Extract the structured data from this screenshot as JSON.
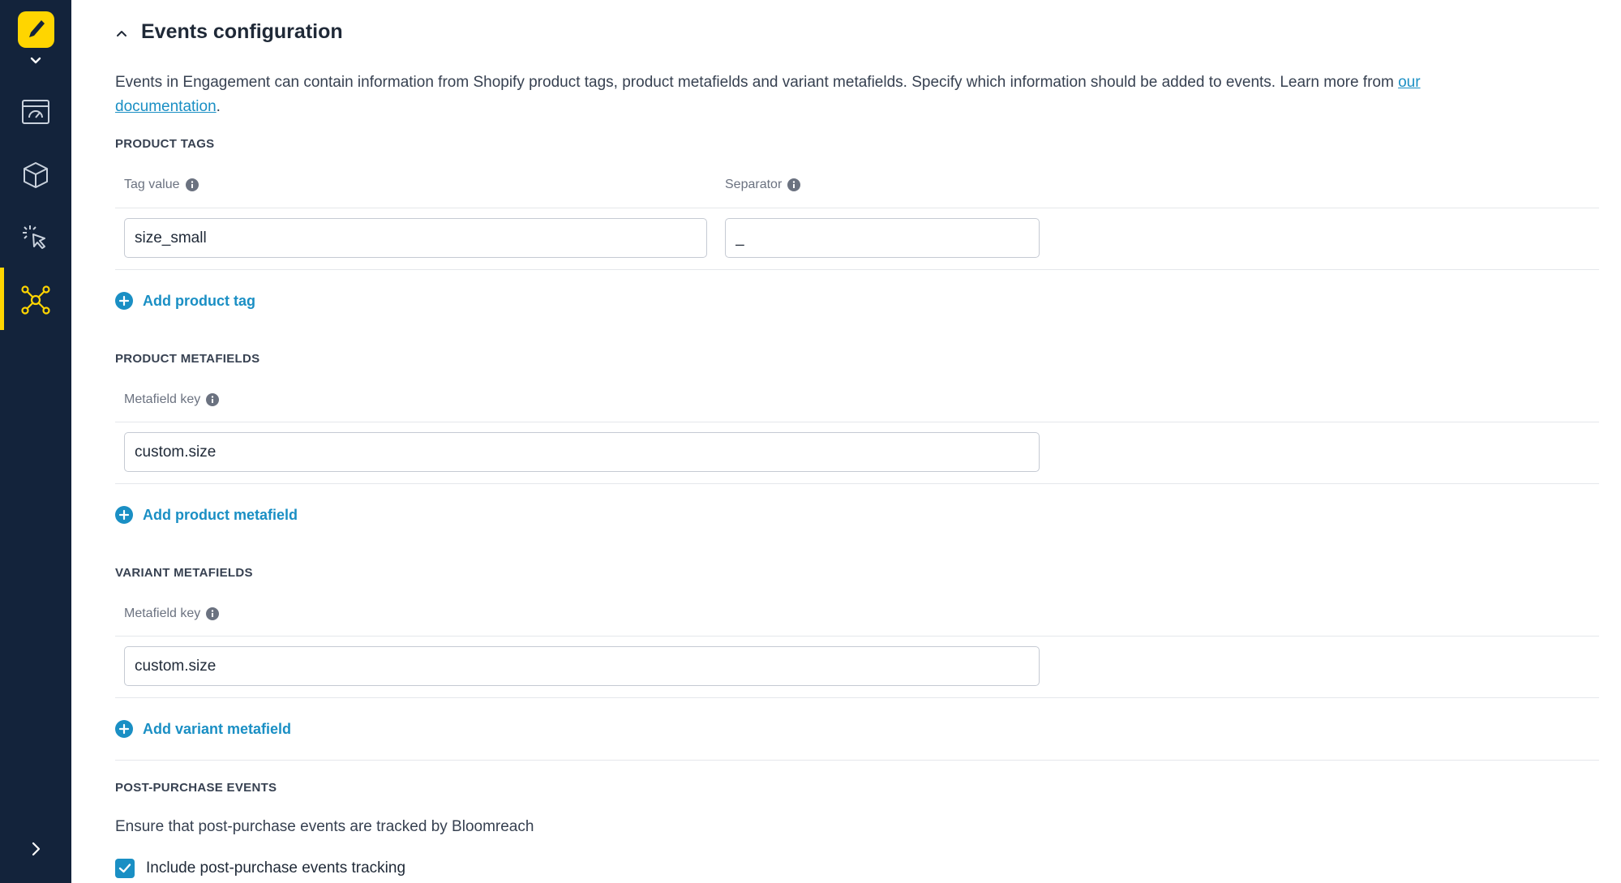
{
  "sidebar": {
    "logo_icon": "bloomreach-logo",
    "items": [
      {
        "icon": "dashboard-icon",
        "active": false
      },
      {
        "icon": "cube-icon",
        "active": false
      },
      {
        "icon": "cursor-click-icon",
        "active": false
      },
      {
        "icon": "network-icon",
        "active": true
      }
    ],
    "accent_color": "#ffd500",
    "background_color": "#13233b"
  },
  "section": {
    "title": "Events configuration",
    "description": "Events in Engagement can contain information from Shopify product tags, product metafields and variant metafields. Specify which information should be added to events. Learn more from ",
    "doc_link": "our documentation",
    "description_end": "."
  },
  "product_tags": {
    "title": "PRODUCT TAGS",
    "tag_label": "Tag value",
    "separator_label": "Separator",
    "tag_value": "size_small",
    "separator_value": "_",
    "add_label": "Add product tag"
  },
  "product_metafields": {
    "title": "PRODUCT METAFIELDS",
    "key_label": "Metafield key",
    "key_value": "custom.size",
    "add_label": "Add product metafield"
  },
  "variant_metafields": {
    "title": "VARIANT METAFIELDS",
    "key_label": "Metafield key",
    "key_value": "custom.size",
    "add_label": "Add variant metafield"
  },
  "post_purchase": {
    "title": "POST-PURCHASE EVENTS",
    "description": "Ensure that post-purchase events are tracked by Bloomreach",
    "checkbox_label": "Include post-purchase events tracking",
    "checked": true
  },
  "link_color": "#1a8fc4"
}
